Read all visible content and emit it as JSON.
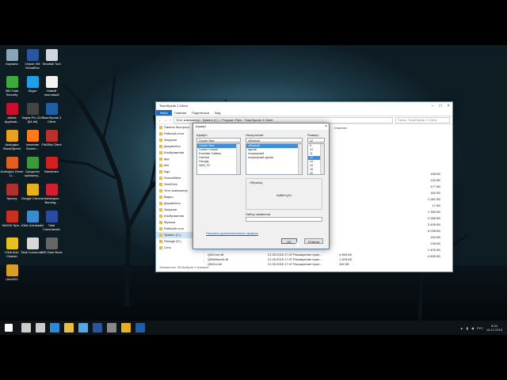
{
  "desktop": {
    "icons": [
      {
        "label": "Корзина",
        "color": "#8aa4b8"
      },
      {
        "label": "Oracle VM VirtualBox",
        "color": "#2a56a0"
      },
      {
        "label": "Smartall Tool",
        "color": "#cfd6dc"
      },
      {
        "label": "360 Total Security",
        "color": "#3caa3c"
      },
      {
        "label": "Skype",
        "color": "#1fa0e6"
      },
      {
        "label": "Новый текстовый",
        "color": "#f2f2f2"
      },
      {
        "label": "Adobe Applicati...",
        "color": "#c8102e"
      },
      {
        "label": "Vegas Pro 13.0 (64-bit)",
        "color": "#444"
      },
      {
        "label": "TeamSpeak 3 Client",
        "color": "#1f5fa6"
      },
      {
        "label": "Auslogics BoostSpeed",
        "color": "#e8a020"
      },
      {
        "label": "Icecream Screen...",
        "color": "#ff7a1a"
      },
      {
        "label": "FileZilla Client",
        "color": "#b8322b"
      },
      {
        "label": "Auslogics Driver U...",
        "color": "#e06020"
      },
      {
        "label": "Средство просмотр...",
        "color": "#3c9a3c"
      },
      {
        "label": "Bandicam",
        "color": "#d02020"
      },
      {
        "label": "Speccy",
        "color": "#b03030"
      },
      {
        "label": "Google Chrome",
        "color": "#e6b020"
      },
      {
        "label": "Ashampoo Burning...",
        "color": "#d02030"
      },
      {
        "label": "MAGIX Spe...",
        "color": "#c83020"
      },
      {
        "label": "IObit Uninstaller",
        "color": "#3a8ad0"
      },
      {
        "label": "Total Commander",
        "color": "#2a4aa0"
      },
      {
        "label": "IObit Auto Cleaner",
        "color": "#e8c020"
      },
      {
        "label": "Total Communi...",
        "color": "#d8d8d8"
      },
      {
        "label": "MSI Dark Book",
        "color": "#666"
      },
      {
        "label": "UltraISO",
        "color": "#d8a020"
      }
    ]
  },
  "explorer": {
    "title": "TeamSpeak 3 Client",
    "ribbon": {
      "file": "Файл",
      "tabs": [
        "Главная",
        "Поделиться",
        "Вид"
      ]
    },
    "address": [
      "Этот компьютер",
      "System (C:)",
      "Program Files",
      "TeamSpeak 3 Client"
    ],
    "search_placeholder": "Поиск: TeamSpeak 3 Client",
    "column_modified": "Изменен",
    "nav": [
      {
        "label": "Панель быстрого",
        "sel": false
      },
      {
        "label": "Рабочий стол",
        "sel": false
      },
      {
        "label": "Загрузки",
        "sel": false
      },
      {
        "label": "Документы",
        "sel": false
      },
      {
        "label": "Изображения",
        "sel": false
      },
      {
        "label": "app",
        "sel": false
      },
      {
        "label": "bilo",
        "sel": false
      },
      {
        "label": "logo",
        "sel": false
      },
      {
        "label": "SonuckBest",
        "sel": false
      },
      {
        "label": "OneDrive",
        "sel": false
      },
      {
        "label": "Этот компьютер",
        "sel": false
      },
      {
        "label": "Видео",
        "sel": false
      },
      {
        "label": "Документы",
        "sel": false
      },
      {
        "label": "Загрузки",
        "sel": false
      },
      {
        "label": "Изображения",
        "sel": false
      },
      {
        "label": "Музыка",
        "sel": false
      },
      {
        "label": "Рабочий стол",
        "sel": false
      },
      {
        "label": "System (C:)",
        "sel": true
      },
      {
        "label": "Storage (D:)",
        "sel": false
      },
      {
        "label": "Сеть",
        "sel": false
      }
    ],
    "sizes": [
      "158 КБ",
      "130 КБ",
      "477 КБ",
      "160 КБ",
      "1 081 КБ",
      "17 КБ",
      "1 380 КБ",
      "2 085 КБ",
      "3 495 КБ",
      "6 038 КБ",
      "163 КБ",
      "246 КБ",
      "1 405 КБ",
      "4 895 КБ"
    ],
    "files": [
      {
        "name": "Qt5Core.dll",
        "date": "21.05.2015 17:47",
        "type": "Расширение прил...",
        "size": "4 895 КБ"
      },
      {
        "name": "Qt5Network.dll",
        "date": "21.05.2015 17:47",
        "type": "Расширение прил...",
        "size": "1 405 КБ"
      },
      {
        "name": "Qt5Gui.dll",
        "date": "21.05.2015 17:47",
        "type": "Расширение прил...",
        "size": "246 КБ"
      }
    ],
    "status": "Элементов: 36 Выбран 1 элемент"
  },
  "font_dialog": {
    "title": "Шрифт",
    "font_label": "Шрифт:",
    "style_label": "Начертание:",
    "size_label": "Размер:",
    "font_value": "Courier New",
    "style_value": "обычный",
    "size_value": "12",
    "fonts": [
      {
        "label": "Courier New",
        "sel": true
      },
      {
        "label": "Lucida Console",
        "sel": false
      },
      {
        "label": "Evanlake Galilean",
        "sel": false
      },
      {
        "label": "Gabriola",
        "sel": false
      },
      {
        "label": "Georgia",
        "sel": false
      },
      {
        "label": "HMG_Fil",
        "sel": false
      }
    ],
    "styles": [
      {
        "label": "обычный",
        "sel": true
      },
      {
        "label": "курсив",
        "sel": false
      },
      {
        "label": "полужирный",
        "sel": false
      },
      {
        "label": "полужирный курсив",
        "sel": false
      }
    ],
    "sizes": [
      {
        "label": "9",
        "sel": false
      },
      {
        "label": "10",
        "sel": false
      },
      {
        "label": "11",
        "sel": false
      },
      {
        "label": "12",
        "sel": true
      },
      {
        "label": "14",
        "sel": false
      },
      {
        "label": "16",
        "sel": false
      },
      {
        "label": "18",
        "sel": false
      },
      {
        "label": "20",
        "sel": false
      }
    ],
    "sample_label": "Образец",
    "sample_text": "AaBbYyZz",
    "charset_label": "Набор символов:",
    "link": "Показать дополнительные шрифты",
    "ok": "OK",
    "cancel": "Отмена"
  },
  "taskbar": {
    "icons": [
      {
        "name": "start-icon",
        "color": "#ffffff"
      },
      {
        "name": "search-icon",
        "color": "#cccccc"
      },
      {
        "name": "task-view-icon",
        "color": "#cccccc"
      },
      {
        "name": "edge-icon",
        "color": "#2a8ad8"
      },
      {
        "name": "explorer-icon",
        "color": "#e8c040"
      },
      {
        "name": "store-icon",
        "color": "#58a8e0"
      },
      {
        "name": "virtualbox-icon",
        "color": "#2a56a0"
      },
      {
        "name": "game-icon",
        "color": "#888888"
      },
      {
        "name": "chrome-icon",
        "color": "#e6b020"
      },
      {
        "name": "teamspeak-icon",
        "color": "#1f5fa6"
      }
    ],
    "lang": "РУС",
    "time": "8:34",
    "date": "16.12.2015"
  }
}
